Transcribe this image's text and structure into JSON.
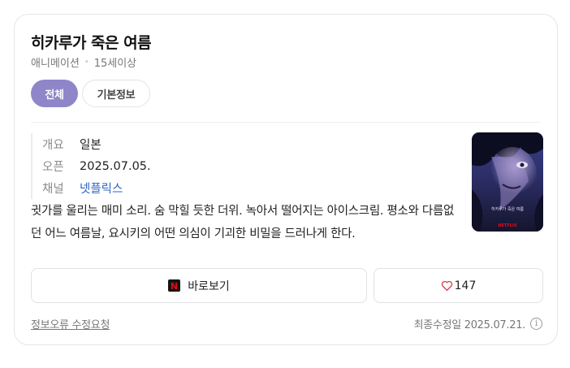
{
  "header": {
    "title": "히카루가 죽은 여름",
    "genre": "애니메이션",
    "rating": "15세이상"
  },
  "tabs": [
    {
      "label": "전체",
      "active": true
    },
    {
      "label": "기본정보",
      "active": false
    }
  ],
  "info": {
    "overview_label": "개요",
    "overview_value": "일본",
    "open_label": "오픈",
    "open_value": "2025.07.05.",
    "channel_label": "채널",
    "channel_value": "넷플릭스"
  },
  "poster": {
    "title_text": "히카루가 죽은 여름",
    "brand_text": "NETFLIX"
  },
  "description": "귓가를 울리는 매미 소리. 숨 막힐 듯한 더위. 녹아서 떨어지는 아이스크림. 평소와 다름없던 어느 여름날, 요시키의 어떤 의심이 기괴한 비밀을 드러나게 한다.",
  "actions": {
    "watch_label": "바로보기",
    "netflix_logo_letter": "N",
    "like_count": "147"
  },
  "footer": {
    "report_link": "정보오류 수정요청",
    "updated_text": "최종수정일 2025.07.21.",
    "info_icon_glyph": "i"
  },
  "colors": {
    "accent": "#8f86c9",
    "link": "#2b63c6",
    "heart": "#e0405a",
    "netflix_red": "#e50914"
  }
}
